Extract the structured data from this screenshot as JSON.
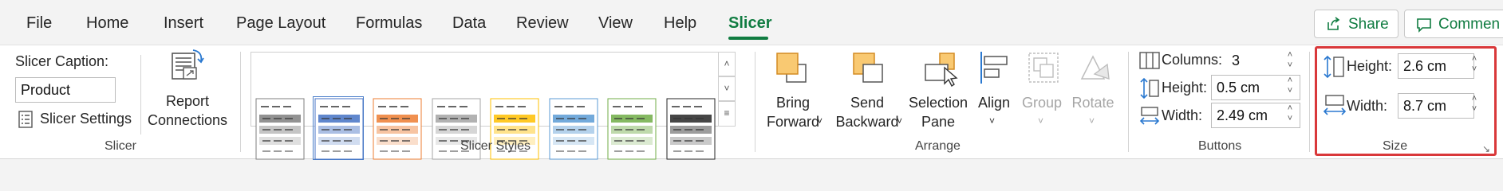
{
  "tabs": [
    {
      "label": "File"
    },
    {
      "label": "Home"
    },
    {
      "label": "Insert"
    },
    {
      "label": "Page Layout"
    },
    {
      "label": "Formulas"
    },
    {
      "label": "Data"
    },
    {
      "label": "Review"
    },
    {
      "label": "View"
    },
    {
      "label": "Help"
    },
    {
      "label": "Slicer",
      "active": true
    }
  ],
  "share_label": "Share",
  "comments_label": "Commen",
  "slicer_group": {
    "caption_label": "Slicer Caption:",
    "caption_value": "Product",
    "settings_label": "Slicer Settings",
    "report_label_1": "Report",
    "report_label_2": "Connections",
    "group_label": "Slicer"
  },
  "styles_group": {
    "group_label": "Slicer Styles",
    "tile_colors": [
      "#7f7f7f",
      "#4472c4",
      "#ed7d31",
      "#a5a5a5",
      "#ffc000",
      "#5b9bd5",
      "#70ad47",
      "#262626"
    ]
  },
  "arrange_group": {
    "group_label": "Arrange",
    "bring_forward_1": "Bring",
    "bring_forward_2": "Forward",
    "send_backward_1": "Send",
    "send_backward_2": "Backward",
    "selection_pane_1": "Selection",
    "selection_pane_2": "Pane",
    "align": "Align",
    "group": "Group",
    "rotate": "Rotate"
  },
  "buttons_group": {
    "group_label": "Buttons",
    "columns_label": "Columns:",
    "columns_value": "3",
    "height_label": "Height:",
    "height_value": "0.5 cm",
    "width_label": "Width:",
    "width_value": "2.49 cm"
  },
  "size_group": {
    "group_label": "Size",
    "height_label": "Height:",
    "height_value": "2.6 cm",
    "width_label": "Width:",
    "width_value": "8.7 cm"
  },
  "colors": {
    "accent": "#107c41",
    "highlight": "#d9383a"
  }
}
